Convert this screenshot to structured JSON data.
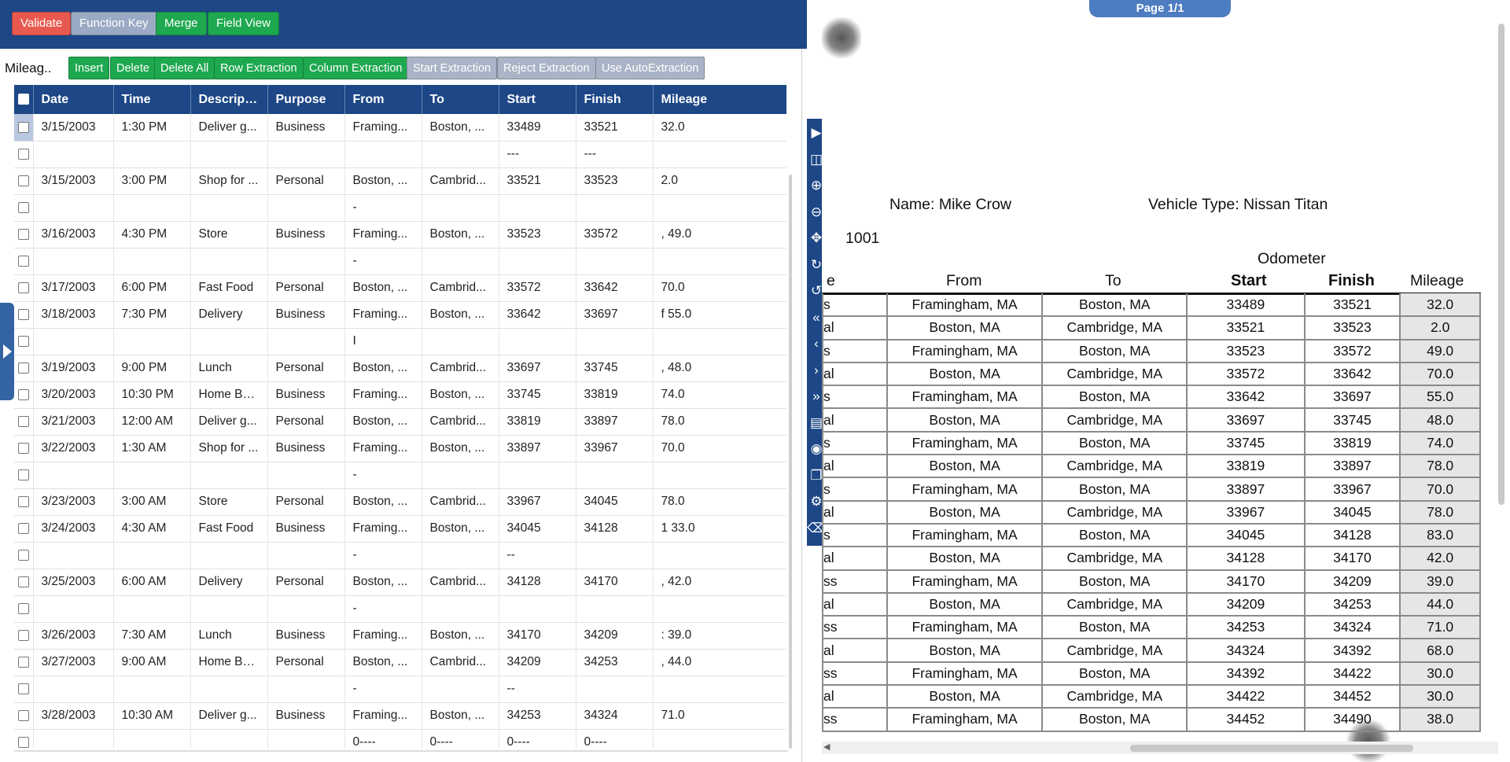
{
  "toolbar": {
    "validate": "Validate",
    "function_key": "Function Key",
    "merge": "Merge",
    "field_view": "Field View"
  },
  "grid": {
    "label": "Mileag..",
    "buttons": {
      "insert": "Insert",
      "delete": "Delete",
      "delete_all": "Delete All",
      "row_extraction": "Row Extraction",
      "column_extraction": "Column Extraction",
      "start_extraction": "Start Extraction",
      "reject_extraction": "Reject Extraction",
      "use_autoextraction": "Use AutoExtraction"
    },
    "columns": [
      "Date",
      "Time",
      "Descripti...",
      "Purpose",
      "From",
      "To",
      "Start",
      "Finish",
      "Mileage"
    ],
    "rows": [
      [
        "3/15/2003",
        "1:30 PM",
        "Deliver g...",
        "Business",
        "Framing...",
        "Boston, ...",
        "33489",
        "33521",
        "32.0"
      ],
      [
        "",
        "",
        "",
        "",
        "",
        "",
        "---",
        "---",
        ""
      ],
      [
        "3/15/2003",
        "3:00 PM",
        "Shop for ...",
        "Personal",
        "Boston, ...",
        "Cambrid...",
        "33521",
        "33523",
        "2.0"
      ],
      [
        "",
        "",
        "",
        "",
        "-",
        "",
        "",
        "",
        ""
      ],
      [
        "3/16/2003",
        "4:30 PM",
        "Store",
        "Business",
        "Framing...",
        "Boston, ...",
        "33523",
        "33572",
        ", 49.0"
      ],
      [
        "",
        "",
        "",
        "",
        "-",
        "",
        "",
        "",
        ""
      ],
      [
        "3/17/2003",
        "6:00 PM",
        "Fast Food",
        "Personal",
        "Boston, ...",
        "Cambrid...",
        "33572",
        "33642",
        "70.0"
      ],
      [
        "3/18/2003",
        "7:30 PM",
        "Delivery",
        "Business",
        "Framing...",
        "Boston, ...",
        "33642",
        "33697",
        "f 55.0"
      ],
      [
        "",
        "",
        "",
        "",
        "I",
        "",
        "",
        "",
        ""
      ],
      [
        "3/19/2003",
        "9:00 PM",
        "Lunch",
        "Personal",
        "Boston, ...",
        "Cambrid...",
        "33697",
        "33745",
        ", 48.0"
      ],
      [
        "3/20/2003",
        "10:30 PM",
        "Home Ba...",
        "Business",
        "Framing...",
        "Boston, ...",
        "33745",
        "33819",
        "74.0"
      ],
      [
        "3/21/2003",
        "12:00 AM",
        "Deliver g...",
        "Personal",
        "Boston, ...",
        "Cambrid...",
        "33819",
        "33897",
        "78.0"
      ],
      [
        "3/22/2003",
        "1:30 AM",
        "Shop for ...",
        "Business",
        "Framing...",
        "Boston, ...",
        "33897",
        "33967",
        "70.0"
      ],
      [
        "",
        "",
        "",
        "",
        "-",
        "",
        "",
        "",
        ""
      ],
      [
        "3/23/2003",
        "3:00 AM",
        "Store",
        "Personal",
        "Boston, ...",
        "Cambrid...",
        "33967",
        "34045",
        "78.0"
      ],
      [
        "3/24/2003",
        "4:30 AM",
        "Fast Food",
        "Business",
        "Framing...",
        "Boston, ...",
        "34045",
        "34128",
        "1 33.0"
      ],
      [
        "",
        "",
        "",
        "",
        "-",
        "",
        "--",
        "",
        ""
      ],
      [
        "3/25/2003",
        "6:00 AM",
        "Delivery",
        "Personal",
        "Boston, ...",
        "Cambrid...",
        "34128",
        "34170",
        ", 42.0"
      ],
      [
        "",
        "",
        "",
        "",
        "-",
        "",
        "",
        "",
        ""
      ],
      [
        "3/26/2003",
        "7:30 AM",
        "Lunch",
        "Business",
        "Framing...",
        "Boston, ...",
        "34170",
        "34209",
        ": 39.0"
      ],
      [
        "3/27/2003",
        "9:00 AM",
        "Home Ba...",
        "Personal",
        "Boston, ...",
        "Cambrid...",
        "34209",
        "34253",
        ", 44.0"
      ],
      [
        "",
        "",
        "",
        "",
        "-",
        "",
        "--",
        "",
        ""
      ],
      [
        "3/28/2003",
        "10:30 AM",
        "Deliver g...",
        "Business",
        "Framing...",
        "Boston, ...",
        "34253",
        "34324",
        "71.0"
      ],
      [
        "",
        "",
        "",
        "",
        "0----",
        "0----",
        "0----",
        "0----",
        ""
      ]
    ]
  },
  "viewer": {
    "page_indicator": "Page 1/1",
    "name_line": "Name: Mike Crow",
    "vehicle_line": "Vehicle Type: Nissan Titan",
    "number": "1001",
    "odometer_label": "Odometer",
    "headers": {
      "purpose_partial": "e",
      "from": "From",
      "to": "To",
      "start": "Start",
      "finish": "Finish",
      "mileage": "Mileage"
    },
    "rows": [
      [
        "s",
        "Framingham, MA",
        "Boston, MA",
        "33489",
        "33521",
        "32.0"
      ],
      [
        "al",
        "Boston, MA",
        "Cambridge, MA",
        "33521",
        "33523",
        "2.0"
      ],
      [
        "s",
        "Framingham, MA",
        "Boston, MA",
        "33523",
        "33572",
        "49.0"
      ],
      [
        "al",
        "Boston, MA",
        "Cambridge, MA",
        "33572",
        "33642",
        "70.0"
      ],
      [
        "s",
        "Framingham, MA",
        "Boston, MA",
        "33642",
        "33697",
        "55.0"
      ],
      [
        "al",
        "Boston, MA",
        "Cambridge, MA",
        "33697",
        "33745",
        "48.0"
      ],
      [
        "s",
        "Framingham, MA",
        "Boston, MA",
        "33745",
        "33819",
        "74.0"
      ],
      [
        "al",
        "Boston, MA",
        "Cambridge, MA",
        "33819",
        "33897",
        "78.0"
      ],
      [
        "s",
        "Framingham, MA",
        "Boston, MA",
        "33897",
        "33967",
        "70.0"
      ],
      [
        "al",
        "Boston, MA",
        "Cambridge, MA",
        "33967",
        "34045",
        "78.0"
      ],
      [
        "s",
        "Framingham, MA",
        "Boston, MA",
        "34045",
        "34128",
        "83.0"
      ],
      [
        "al",
        "Boston, MA",
        "Cambridge, MA",
        "34128",
        "34170",
        "42.0"
      ],
      [
        "ss",
        "Framingham, MA",
        "Boston, MA",
        "34170",
        "34209",
        "39.0"
      ],
      [
        "al",
        "Boston, MA",
        "Cambridge, MA",
        "34209",
        "34253",
        "44.0"
      ],
      [
        "ss",
        "Framingham, MA",
        "Boston, MA",
        "34253",
        "34324",
        "71.0"
      ],
      [
        "al",
        "Boston, MA",
        "Cambridge, MA",
        "34324",
        "34392",
        "68.0"
      ],
      [
        "ss",
        "Framingham, MA",
        "Boston, MA",
        "34392",
        "34422",
        "30.0"
      ],
      [
        "al",
        "Boston, MA",
        "Cambridge, MA",
        "34422",
        "34452",
        "30.0"
      ],
      [
        "ss",
        "Framingham, MA",
        "Boston, MA",
        "34452",
        "34490",
        "38.0"
      ]
    ]
  },
  "side_tools": [
    "play-icon",
    "two-page-icon",
    "zoom-in-icon",
    "zoom-out-icon",
    "move-icon",
    "rotate-right-icon",
    "rotate-left-icon",
    "first-page-icon",
    "prev-page-icon",
    "next-page-icon",
    "last-page-icon",
    "document-icon",
    "binoculars-icon",
    "copy-pages-icon",
    "wrench-icon",
    "trash-icon"
  ],
  "colors": {
    "header_blue": "#1d4786",
    "green": "#1ea84f",
    "red": "#e8594f",
    "gray_btn": "#9aaac4"
  }
}
